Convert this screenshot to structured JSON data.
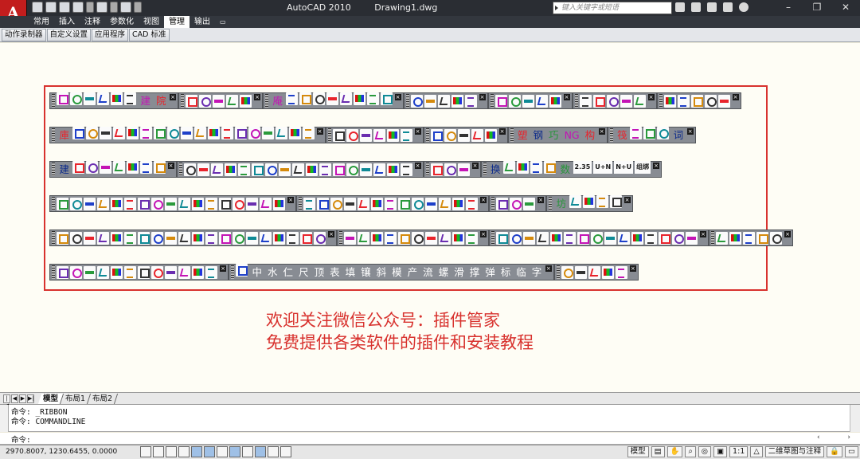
{
  "titlebar": {
    "logo_letter": "A",
    "app_name": "AutoCAD 2010",
    "document": "Drawing1.dwg",
    "search_placeholder": "键入关键字或短语"
  },
  "ribbon": {
    "tabs": [
      {
        "label": "常用",
        "active": false
      },
      {
        "label": "插入",
        "active": false
      },
      {
        "label": "注释",
        "active": false
      },
      {
        "label": "参数化",
        "active": false
      },
      {
        "label": "视图",
        "active": false
      },
      {
        "label": "管理",
        "active": true
      },
      {
        "label": "输出",
        "active": false
      }
    ],
    "panel_buttons": [
      "动作录制器",
      "自定义设置",
      "应用程序",
      "CAD 标准"
    ]
  },
  "toolbars": {
    "row1_labels": [
      "建",
      "院",
      "庵",
      "塑",
      "十",
      "司"
    ],
    "row2_labels": [
      "庫",
      "塑",
      "钢",
      "巧",
      "NG",
      "构",
      "筏",
      "词",
      "字"
    ],
    "row3_labels": [
      "建",
      "换",
      "数",
      "2.35",
      "U+N",
      "N+U",
      "组绑"
    ],
    "row4_labels": [
      "坊"
    ],
    "row6_labels": [
      "中",
      "水",
      "仁",
      "尺",
      "顶",
      "表",
      "填",
      "镶",
      "斜",
      "模",
      "产",
      "流",
      "螺",
      "滑",
      "撑",
      "弹",
      "标",
      "临",
      "字"
    ]
  },
  "promo": {
    "line1": "欢迎关注微信公众号：插件管家",
    "line2": "免费提供各类软件的插件和安装教程"
  },
  "layout_tabs": [
    "模型",
    "布局1",
    "布局2"
  ],
  "command": {
    "history": [
      "命令: _RIBBON",
      "命令: COMMANDLINE"
    ],
    "prompt": "命令:"
  },
  "statusbar": {
    "coordinates": "2970.8007,  1230.6455,  0.0000",
    "model_label": "模型",
    "scale": "1:1",
    "workspace": "二维草图与注释"
  }
}
